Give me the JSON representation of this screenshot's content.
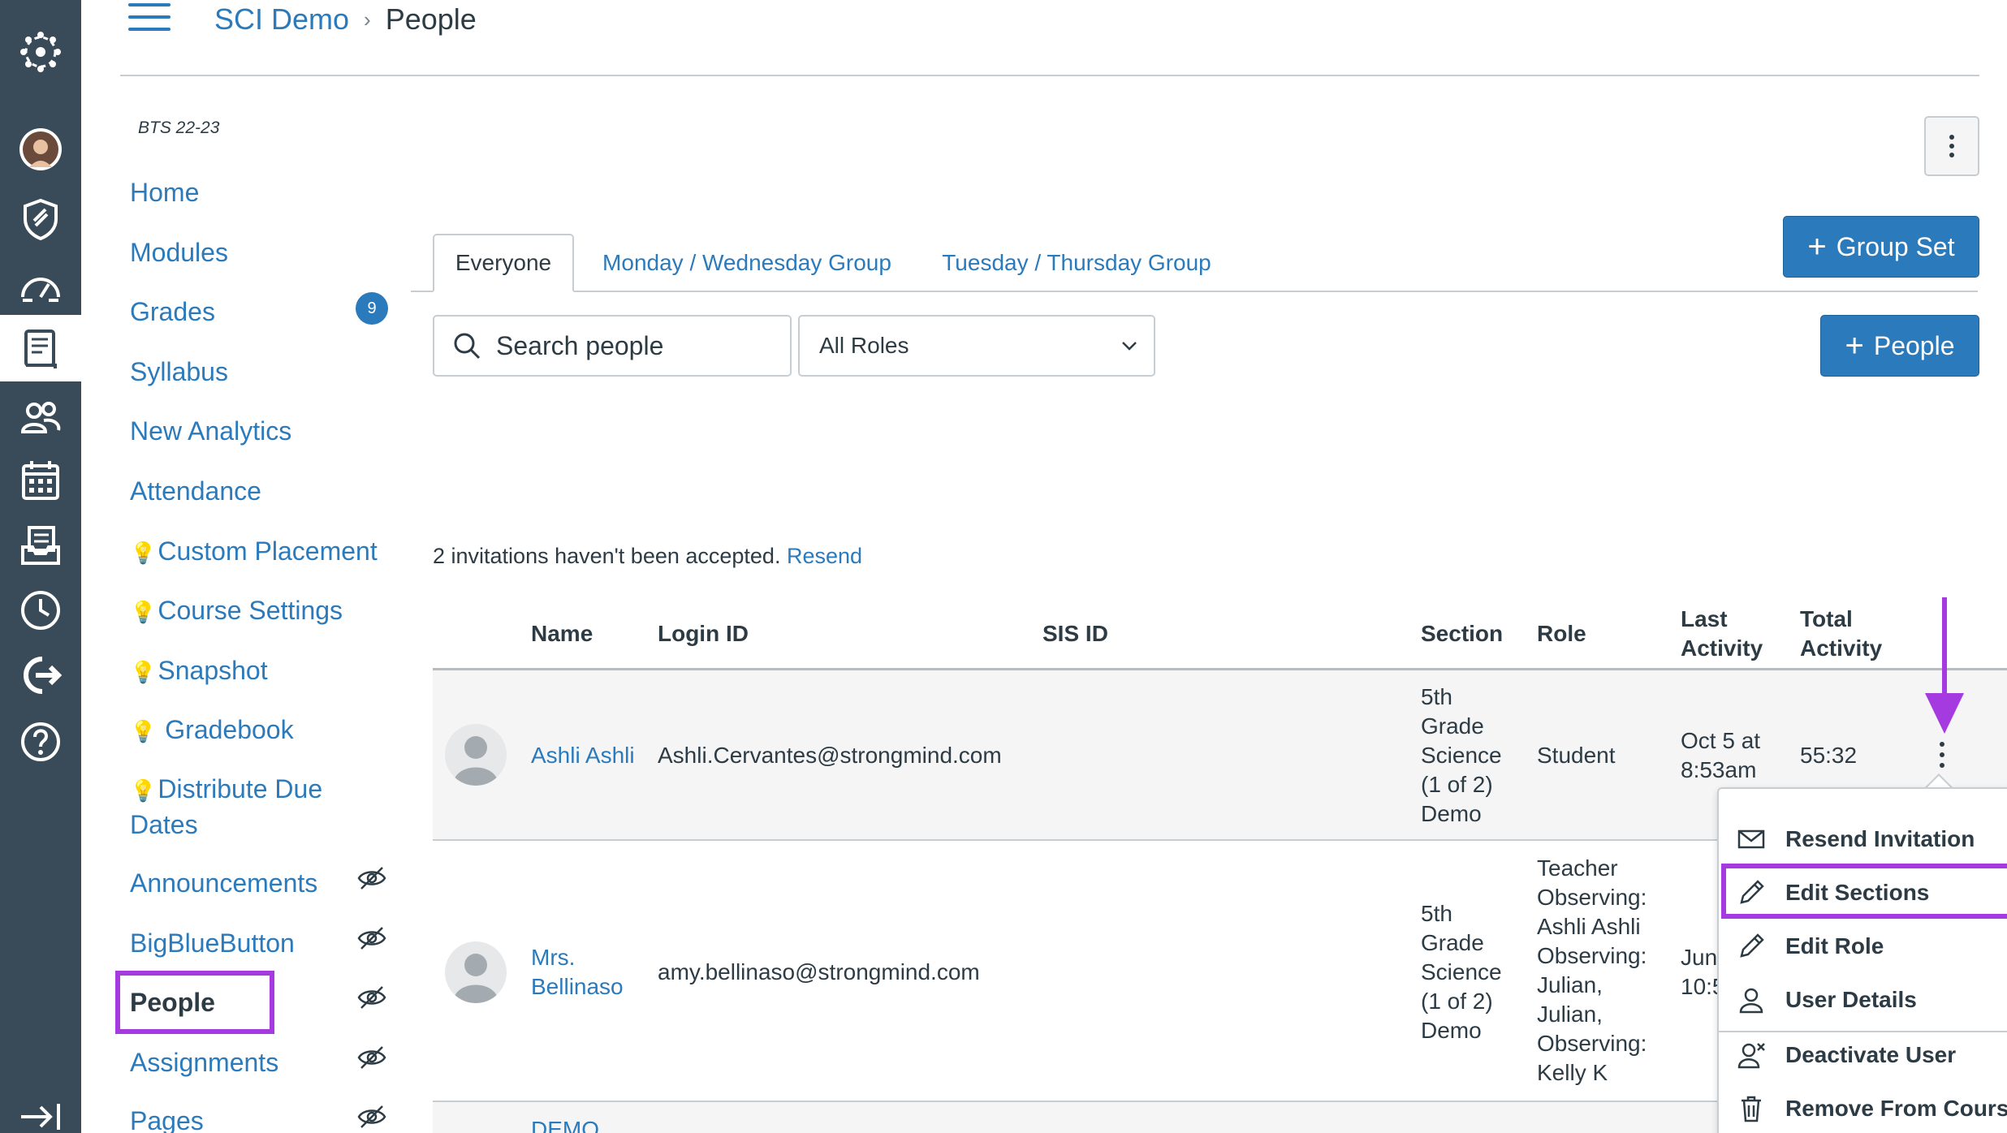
{
  "global_nav": {
    "items": [
      "logo",
      "account",
      "admin",
      "dashboard",
      "courses",
      "groups",
      "calendar",
      "inbox",
      "history",
      "commons",
      "help",
      "collapse"
    ]
  },
  "header": {
    "course": "SCI Demo",
    "separator": "›",
    "current": "People"
  },
  "course_nav": {
    "term": "BTS 22-23",
    "items": [
      {
        "label": "Home"
      },
      {
        "label": "Modules"
      },
      {
        "label": "Grades",
        "badge": "9"
      },
      {
        "label": "Syllabus"
      },
      {
        "label": "New Analytics"
      },
      {
        "label": "Attendance"
      },
      {
        "label": "Custom Placement",
        "bulb": "💡"
      },
      {
        "label": "Course Settings",
        "bulb": "💡"
      },
      {
        "label": "Snapshot",
        "bulb": "💡"
      },
      {
        "label": "Gradebook",
        "bulb": "💡"
      },
      {
        "label": "Distribute Due",
        "label2": "Dates",
        "bulb": "💡"
      },
      {
        "label": "Announcements"
      },
      {
        "label": "BigBlueButton"
      },
      {
        "label": "People"
      },
      {
        "label": "Assignments"
      },
      {
        "label": "Pages"
      }
    ]
  },
  "toolbar": {
    "group_set_label": "Group Set",
    "add_people_label": "People"
  },
  "tabs": [
    {
      "label": "Everyone"
    },
    {
      "label": "Monday / Wednesday Group"
    },
    {
      "label": "Tuesday / Thursday Group"
    }
  ],
  "filters": {
    "search_placeholder": "Search people",
    "roles_value": "All Roles"
  },
  "invitations": {
    "text": "2 invitations haven't been accepted.",
    "resend": "Resend"
  },
  "table": {
    "headers": {
      "name": "Name",
      "login_id": "Login ID",
      "sis_id": "SIS ID",
      "section": "Section",
      "role": "Role",
      "last_activity_1": "Last",
      "last_activity_2": "Activity",
      "total_activity_1": "Total",
      "total_activity_2": "Activity"
    },
    "rows": [
      {
        "name": "Ashli Ashli",
        "login_id": "Ashli.Cervantes@strongmind.com",
        "section": [
          "5th",
          "Grade",
          "Science",
          "(1 of 2)",
          "Demo"
        ],
        "role": "Student",
        "last_activity": [
          "Oct 5 at",
          "8:53am"
        ],
        "total_activity": "55:32"
      },
      {
        "name": [
          "Mrs.",
          "Bellinaso"
        ],
        "login_id": "amy.bellinaso@strongmind.com",
        "section": [
          "5th",
          "Grade",
          "Science",
          "(1 of 2)",
          "Demo"
        ],
        "role": [
          "Teacher",
          "Observing:",
          "Ashli Ashli",
          "Observing:",
          "Julian,",
          "Julian,",
          "Observing:",
          "Kelly K"
        ],
        "last_activity": [
          "Jun",
          "10:5"
        ]
      },
      {
        "name": "DEMO"
      }
    ]
  },
  "row_menu": {
    "items": [
      {
        "label": "Resend Invitation",
        "icon": "envelope-icon"
      },
      {
        "label": "Edit Sections",
        "icon": "pencil-icon"
      },
      {
        "label": "Edit Role",
        "icon": "pencil-icon"
      },
      {
        "label": "User Details",
        "icon": "user-icon"
      },
      {
        "label": "Deactivate User",
        "icon": "user-x-icon"
      },
      {
        "label": "Remove From Course",
        "icon": "trash-icon"
      }
    ]
  },
  "colors": {
    "nav_bg": "#394b58",
    "link": "#2b7abc",
    "primary_button": "#2b7abc",
    "annotation": "#a43ae0"
  }
}
